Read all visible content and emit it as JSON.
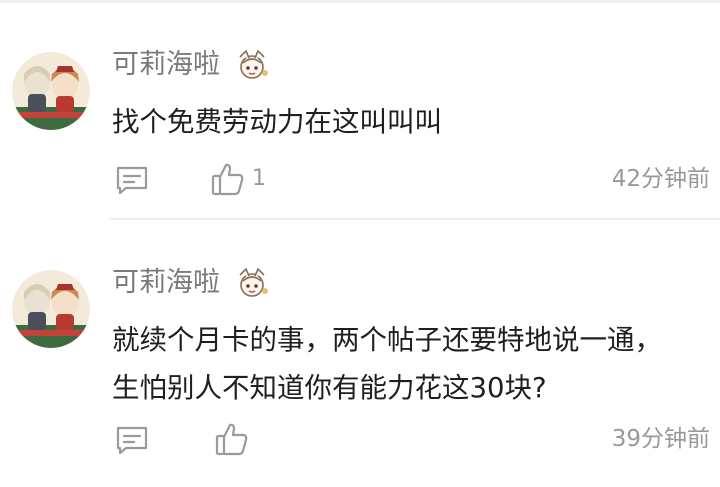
{
  "comments": [
    {
      "username": "可莉海啦",
      "content_lines": [
        "找个免费劳动力在这叫叫叫"
      ],
      "like_count": "1",
      "time": "42分钟前"
    },
    {
      "username": "可莉海啦",
      "content_lines": [
        "就续个月卡的事，两个帖子还要特地说一通，",
        "生怕别人不知道你有能力花这30块?"
      ],
      "like_count": "",
      "time": "39分钟前"
    }
  ],
  "icons": {
    "reply": "comment-bubble-icon",
    "like": "thumbs-up-icon",
    "badge": "paimon-badge-icon"
  }
}
